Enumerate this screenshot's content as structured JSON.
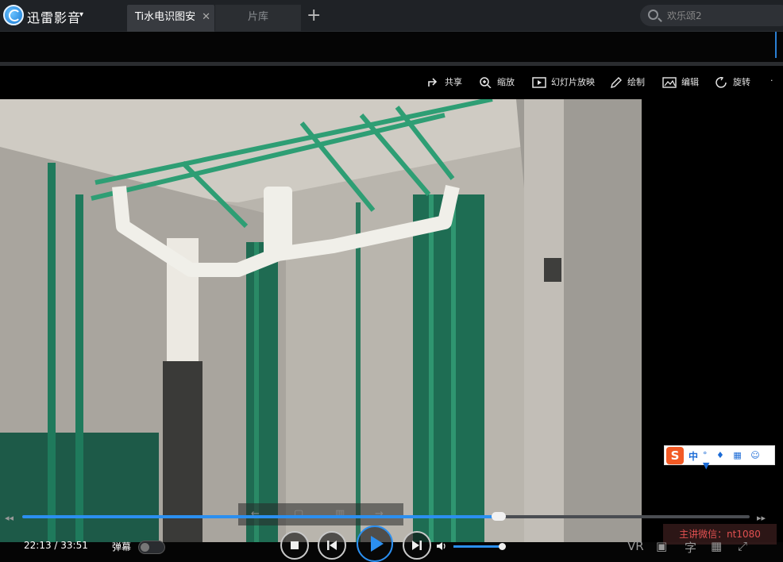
{
  "app": {
    "name": "迅雷影音"
  },
  "tabs": [
    {
      "label": "Ti水电识图安",
      "active": true
    },
    {
      "label": "片库",
      "active": false
    }
  ],
  "search": {
    "placeholder": "欢乐颂2"
  },
  "toolbar": [
    {
      "icon": "share-icon",
      "label": "共享"
    },
    {
      "icon": "zoom-icon",
      "label": "缩放"
    },
    {
      "icon": "slideshow-icon",
      "label": "幻灯片放映"
    },
    {
      "icon": "draw-icon",
      "label": "绘制"
    },
    {
      "icon": "edit-image-icon",
      "label": "编辑"
    },
    {
      "icon": "rotate-icon",
      "label": "旋转"
    },
    {
      "icon": "more-icon",
      "label": "·"
    }
  ],
  "ime": {
    "logo": "S",
    "mode": "中"
  },
  "player": {
    "current_time": "22:13",
    "total_time": "33:51",
    "time_display": "22:13 / 33:51",
    "progress": 0.655,
    "danmu_label": "弹幕",
    "volume": 0.98,
    "vr_label": "VR",
    "subtitle_label": "字",
    "watermark": "主讲微信：nt1080"
  },
  "colors": {
    "accent": "#2b8ff0",
    "titlebar": "#1f2226",
    "pipe_green": "#1f7a5c",
    "pipe_white": "#f0efe9"
  }
}
